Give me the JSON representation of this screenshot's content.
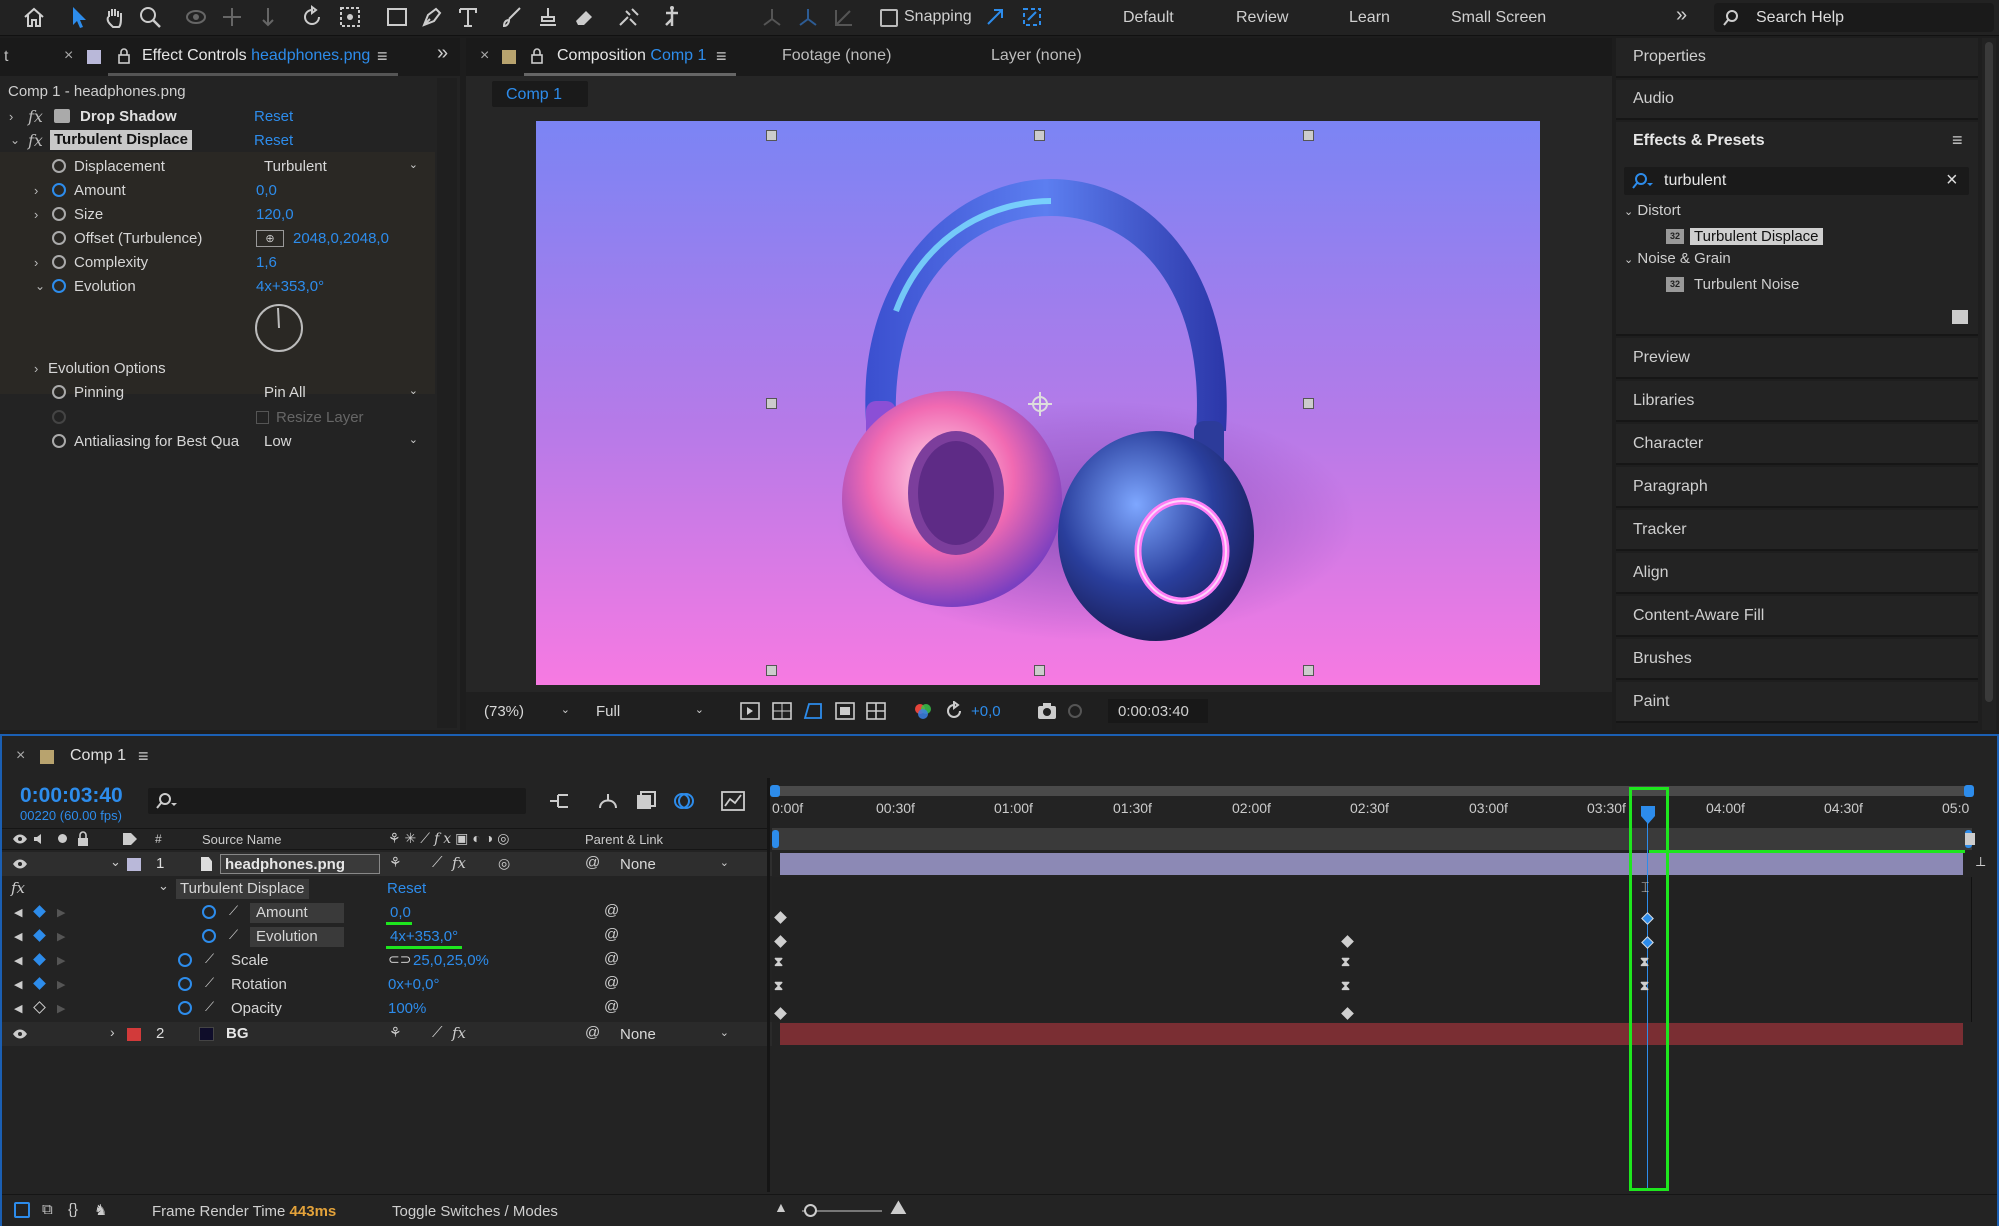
{
  "toolbar": {
    "snapping_label": "Snapping",
    "workspaces": [
      "Default",
      "Review",
      "Learn",
      "Small Screen"
    ],
    "search_placeholder": "Search Help"
  },
  "effect_controls": {
    "tab_prefix": "Effect Controls",
    "tab_file": "headphones.png",
    "cut_label": "t",
    "breadcrumb": "Comp 1 - headphones.png",
    "drop_shadow": {
      "label": "Drop Shadow",
      "reset": "Reset"
    },
    "turbulent": {
      "label": "Turbulent Displace",
      "reset": "Reset"
    },
    "props": {
      "displacement": {
        "label": "Displacement",
        "value": "Turbulent"
      },
      "amount": {
        "label": "Amount",
        "value": "0,0"
      },
      "size": {
        "label": "Size",
        "value": "120,0"
      },
      "offset": {
        "label": "Offset (Turbulence)",
        "value": "2048,0,2048,0"
      },
      "complexity": {
        "label": "Complexity",
        "value": "1,6"
      },
      "evolution": {
        "label": "Evolution",
        "value": "4x+353,0°"
      },
      "evolution_options": {
        "label": "Evolution Options"
      },
      "pinning": {
        "label": "Pinning",
        "value": "Pin All"
      },
      "resize": {
        "label": "Resize Layer"
      },
      "antialias": {
        "label": "Antialiasing for Best Qua",
        "value": "Low"
      }
    }
  },
  "composition": {
    "tab_prefix": "Composition",
    "tab_name": "Comp 1",
    "footage": "Footage (none)",
    "layer": "Layer (none)",
    "subtab": "Comp 1",
    "zoom": "(73%)",
    "resolution": "Full",
    "exposure": "+0,0",
    "timecode": "0:00:03:40"
  },
  "right_panel": {
    "items_top": [
      "Properties",
      "Audio"
    ],
    "effects_title": "Effects & Presets",
    "search_value": "turbulent",
    "tree": [
      {
        "group": "Distort",
        "item": "Turbulent Displace"
      },
      {
        "group": "Noise & Grain",
        "item": "Turbulent Noise"
      }
    ],
    "items_bottom": [
      "Preview",
      "Libraries",
      "Character",
      "Paragraph",
      "Tracker",
      "Align",
      "Content-Aware Fill",
      "Brushes",
      "Paint"
    ]
  },
  "timeline": {
    "tab": "Comp 1",
    "timecode": "0:00:03:40",
    "frame_info": "00220 (60.00 fps)",
    "columns": {
      "source": "Source Name",
      "parent": "Parent & Link",
      "hash": "#"
    },
    "ruler": [
      "0:00f",
      "00:30f",
      "01:00f",
      "01:30f",
      "02:00f",
      "02:30f",
      "03:00f",
      "03:30f",
      "04:00f",
      "04:30f",
      "05:0"
    ],
    "layer1": {
      "num": "1",
      "name": "headphones.png",
      "parent": "None"
    },
    "effect_name": "Turbulent Displace",
    "effect_reset": "Reset",
    "properties": [
      {
        "name": "Amount",
        "value": "0,0"
      },
      {
        "name": "Evolution",
        "value": "4x+353,0°"
      },
      {
        "name": "Scale",
        "value": "25,0,25,0%"
      },
      {
        "name": "Rotation",
        "value": "0x+0,0°"
      },
      {
        "name": "Opacity",
        "value": "100%"
      }
    ],
    "layer2": {
      "num": "2",
      "name": "BG",
      "parent": "None"
    },
    "render_label": "Frame Render Time",
    "render_value": "443ms",
    "toggle_label": "Toggle Switches / Modes"
  },
  "colors": {
    "accent": "#2d8ceb",
    "highlight_green": "#1ee61e",
    "layer1_bar": "#8c89b5",
    "layer2_bar": "#7a2e33",
    "layer2_label": "#d23a3a"
  }
}
